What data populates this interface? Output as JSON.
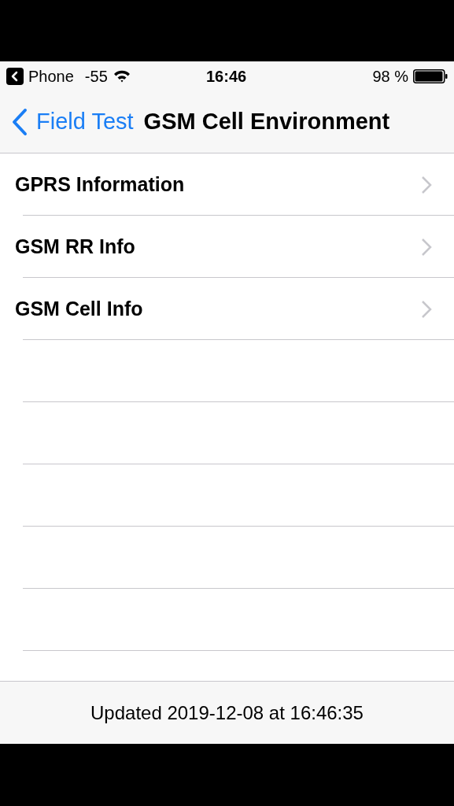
{
  "status_bar": {
    "back_app": "Phone",
    "signal": "-55",
    "time": "16:46",
    "battery": "98 %"
  },
  "nav_bar": {
    "back_label": "Field Test",
    "title": "GSM Cell Environment"
  },
  "rows": [
    {
      "label": "GPRS Information"
    },
    {
      "label": "GSM RR Info"
    },
    {
      "label": "GSM Cell Info"
    }
  ],
  "footer": {
    "text": "Updated 2019-12-08 at 16:46:35"
  }
}
